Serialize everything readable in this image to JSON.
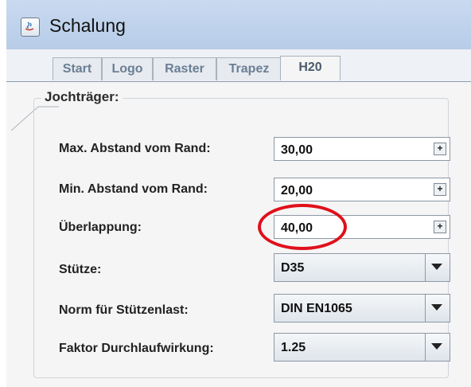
{
  "window": {
    "title": "Schalung"
  },
  "tabs": [
    {
      "label": "Start"
    },
    {
      "label": "Logo"
    },
    {
      "label": "Raster"
    },
    {
      "label": "Trapez"
    },
    {
      "label": "H20",
      "active": true
    }
  ],
  "group": {
    "title": "Jochträger:"
  },
  "fields": [
    {
      "label": "Max. Abstand vom Rand:",
      "value": "30,00",
      "spin": "+"
    },
    {
      "label": "Min. Abstand vom Rand:",
      "value": "20,00",
      "spin": "+"
    },
    {
      "label": "Überlappung:",
      "value": "40,00",
      "spin": "+"
    }
  ],
  "selects": [
    {
      "label": "Stütze:",
      "value": "D35"
    },
    {
      "label": "Norm für Stützenlast:",
      "value": "DIN EN1065"
    },
    {
      "label": "Faktor Durchlaufwirkung:",
      "value": "1.25"
    }
  ],
  "colors": {
    "highlight": "#e0101b",
    "titlebar": "#c9daf0"
  }
}
